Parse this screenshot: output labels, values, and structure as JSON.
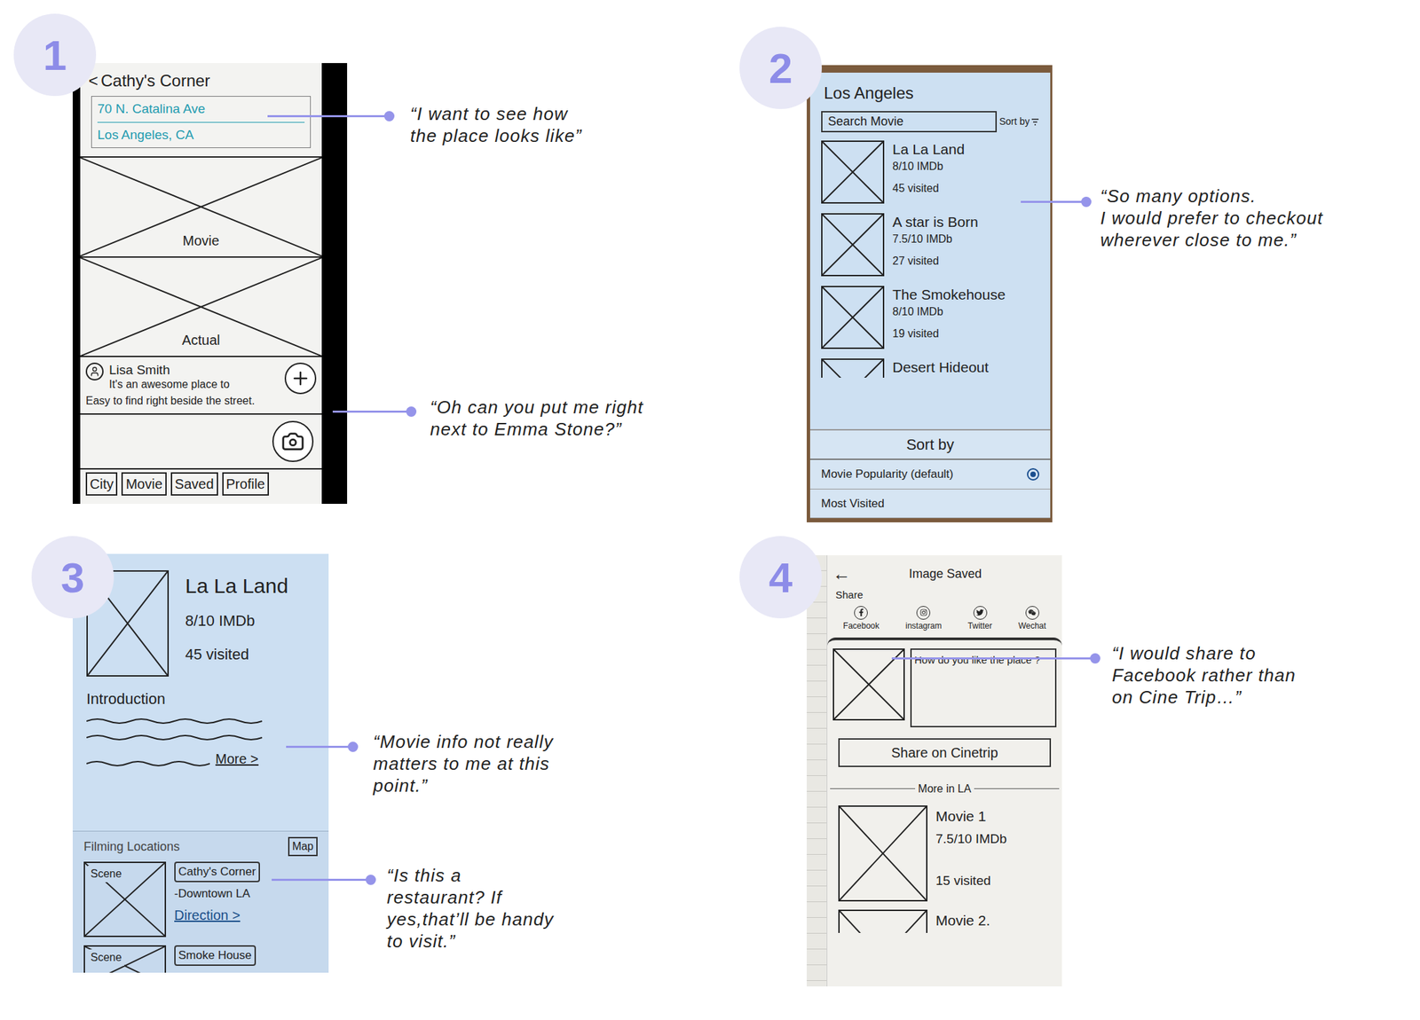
{
  "panels": [
    {
      "number": "1",
      "callouts": [
        {
          "lines": [
            "“I want to see how",
            "the place looks like”"
          ]
        },
        {
          "lines": [
            "“Oh can you put me right",
            "next to Emma Stone?”"
          ]
        }
      ],
      "screen": {
        "back": "<",
        "title": "Cathy's Corner",
        "address": [
          "70 N. Catalina Ave",
          "Los Angeles, CA"
        ],
        "images": [
          "Movie",
          "Actual"
        ],
        "review": {
          "name": "Lisa Smith",
          "line1": "It's an awesome place to",
          "line2": "Easy to find right beside the street."
        },
        "nav": [
          {
            "label": "City",
            "selected": false
          },
          {
            "label": "Movie",
            "selected": false
          },
          {
            "label": "Saved",
            "selected": false
          },
          {
            "label": "Profile",
            "selected": false
          }
        ]
      }
    },
    {
      "number": "2",
      "callouts": [
        {
          "lines": [
            "“So many options.",
            "I would prefer to checkout",
            "wherever close to me.”"
          ]
        }
      ],
      "screen": {
        "title": "Los Angeles",
        "search": {
          "placeholder": "Search Movie"
        },
        "sort": "Sort by",
        "movies": [
          {
            "title": "La La Land",
            "rating": "8/10 IMDb",
            "visited": "45 visited"
          },
          {
            "title": "A star is Born",
            "rating": "7.5/10 IMDb",
            "visited": "27 visited"
          },
          {
            "title": "The Smokehouse",
            "rating": "8/10 IMDb",
            "visited": "19 visited"
          }
        ],
        "partial_movie": "Desert Hideout",
        "sheet": {
          "title": "Sort by",
          "options": [
            {
              "label": "Movie Popularity (default)",
              "selected": true
            },
            {
              "label": "Most Visited",
              "selected": false
            }
          ]
        }
      }
    },
    {
      "number": "3",
      "callouts": [
        {
          "lines": [
            "“Movie info not really",
            "matters to me at this",
            "point.”"
          ]
        },
        {
          "lines": [
            "“Is this a",
            "restaurant? If",
            "yes,that’ll be handy",
            "to visit.”"
          ]
        }
      ],
      "screen": {
        "title": "La La Land",
        "rating": "8/10 IMDb",
        "visited": "45 visited",
        "intro": "Introduction",
        "more": "More >",
        "section": "Filming Locations",
        "map": "Map",
        "location": {
          "scene": "Scene",
          "name": "Cathy's Corner",
          "area": "-Downtown LA",
          "direction": "Direction >"
        },
        "next_location": {
          "scene": "Scene",
          "name": "Smoke House"
        }
      }
    },
    {
      "number": "4",
      "callouts": [
        {
          "lines": [
            "“I would share to",
            "Facebook rather than",
            "on Cine Trip…”"
          ]
        }
      ],
      "screen": {
        "back": "←",
        "title": "Image Saved",
        "share": "Share",
        "networks": [
          "Facebook",
          "instagram",
          "Twitter",
          "Wechat"
        ],
        "prompt": "How do you like the place ?",
        "button": "Share on Cinetrip",
        "section": "More in LA",
        "movie": {
          "title": "Movie 1",
          "rating": "7.5/10 IMDb",
          "visited": "15 visited"
        },
        "partial_movie": "Movie 2."
      }
    }
  ]
}
